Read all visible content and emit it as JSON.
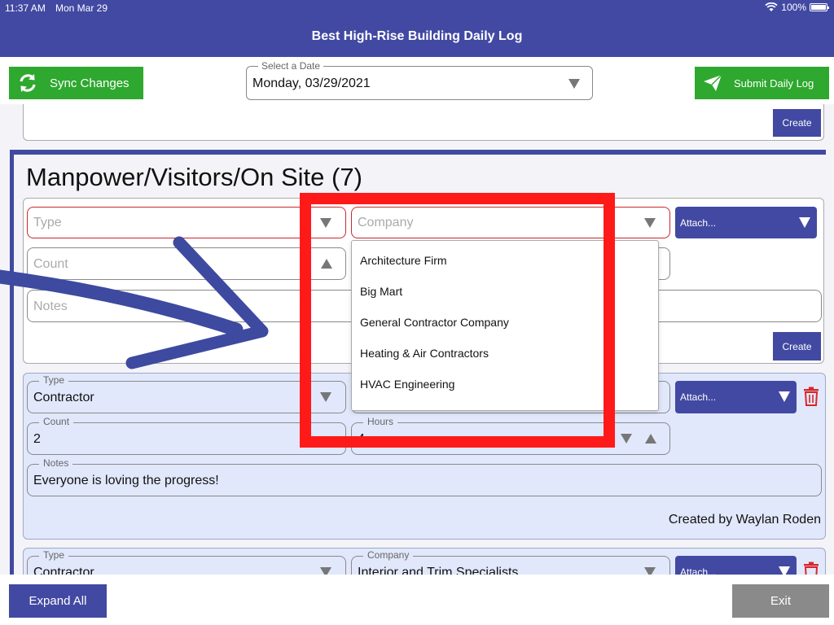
{
  "status_bar": {
    "time": "11:37 AM",
    "date": "Mon Mar 29",
    "battery": "100%"
  },
  "header": {
    "title": "Best High-Rise Building Daily Log"
  },
  "toolbar": {
    "sync_label": "Sync Changes",
    "date_legend": "Select a Date",
    "date_value": "Monday, 03/29/2021",
    "submit_label": "Submit Daily Log"
  },
  "previous_section": {
    "create_label": "Create"
  },
  "manpower": {
    "heading": "Manpower/Visitors/On Site (7)",
    "new_entry": {
      "type_placeholder": "Type",
      "company_placeholder": "Company",
      "attach_label": "Attach...",
      "count_placeholder": "Count",
      "notes_placeholder": "Notes",
      "create_label": "Create"
    },
    "company_dropdown": {
      "options": [
        "Architecture Firm",
        "Big Mart",
        "General Contractor Company",
        "Heating & Air Contractors",
        "HVAC Engineering"
      ]
    },
    "entries": [
      {
        "type_legend": "Type",
        "type_value": "Contractor",
        "attach_label": "Attach...",
        "count_legend": "Count",
        "count_value": "2",
        "hours_legend": "Hours",
        "hours_value": "4",
        "notes_legend": "Notes",
        "notes_value": "Everyone is loving the progress!",
        "created_by_label": "Created by",
        "created_by_name": "Waylan Roden"
      },
      {
        "type_legend": "Type",
        "type_value": "Contractor",
        "company_legend": "Company",
        "company_value": "Interior and Trim Specialists",
        "attach_label": "Attach..."
      }
    ]
  },
  "footer": {
    "expand_label": "Expand All",
    "exit_label": "Exit"
  },
  "colors": {
    "header": "#4249a2",
    "primary_button": "#4249a2",
    "green_button": "#2ea82e",
    "exit_button": "#8a8a8a",
    "annotation_red": "#ff1a1a",
    "card_background": "#e1e8fb",
    "required_border": "#c9282d",
    "trash_red": "#d9262b"
  }
}
